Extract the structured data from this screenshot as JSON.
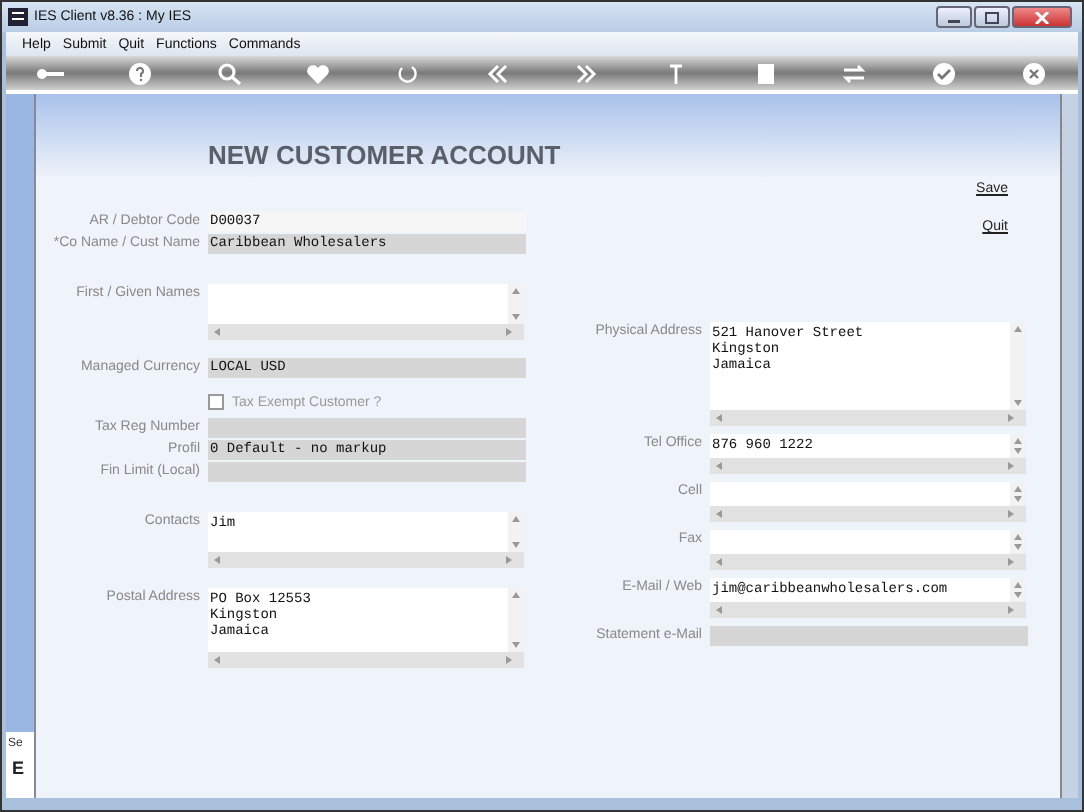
{
  "window": {
    "title": "IES Client v8.36 : My IES"
  },
  "menu": [
    "Help",
    "Submit",
    "Quit",
    "Functions",
    "Commands"
  ],
  "form": {
    "title": "NEW CUSTOMER ACCOUNT",
    "actions": [
      "Save",
      "Quit"
    ],
    "left": [
      {
        "kind": "line",
        "label": "AR / Debtor Code",
        "value": "D00037",
        "editable": true
      },
      {
        "kind": "line",
        "label": "*Co Name / Cust Name",
        "value": "Caribbean Wholesalers",
        "editable": false
      },
      {
        "kind": "textarea",
        "label": "First / Given Names"
      },
      {
        "kind": "line",
        "label": "Managed Currency",
        "value": "LOCAL USD",
        "editable": false
      },
      {
        "kind": "checkbox",
        "label": "Tax Exempt Customer ?",
        "checked": false
      },
      {
        "kind": "line",
        "label": "Tax Reg Number",
        "editable": false
      },
      {
        "kind": "line",
        "label": "Profil",
        "value": "0 Default - no markup",
        "editable": false
      },
      {
        "kind": "line",
        "label": "Fin Limit (Local)",
        "editable": false
      },
      {
        "kind": "textarea",
        "label": "Contacts",
        "value": "Jim"
      },
      {
        "kind": "tall-textarea",
        "label": "Postal Address",
        "value": "PO Box 12553\nKingston\nJamaica"
      }
    ],
    "right": [
      {
        "kind": "tall-textarea",
        "label": "Physical Address",
        "value": "521 Hanover Street\nKingston\nJamaica"
      },
      {
        "kind": "spinner",
        "label": "Tel Office",
        "value": "876 960 1222"
      },
      {
        "kind": "spinner",
        "label": "Cell"
      },
      {
        "kind": "spinner",
        "label": "Fax"
      },
      {
        "kind": "spinner",
        "label": "E-Mail / Web",
        "value": "jim@caribbeanwholesalers.com"
      },
      {
        "kind": "line",
        "label": "Statement e-Mail",
        "editable": false
      }
    ]
  },
  "side_panel": {
    "texts": [
      "Se",
      "E"
    ]
  }
}
